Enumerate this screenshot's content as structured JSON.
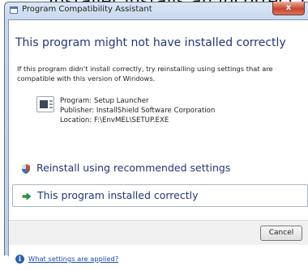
{
  "background": {
    "cut_text": "Installer installs an incorrect r"
  },
  "window": {
    "title": "Program Compatibility Assistant",
    "close_label": "x"
  },
  "main": {
    "heading": "This program might not have installed correctly",
    "description": "If this program didn't install correctly, try reinstalling using settings that are compatible with this version of Windows.",
    "program": {
      "name_line": "Program: Setup Launcher",
      "publisher_line": "Publisher: InstallShield Software Corporation",
      "location_line": "Location: F:\\EnvMEL\\SETUP.EXE",
      "icon": "setup-program-icon"
    },
    "options": [
      {
        "label": "Reinstall using recommended settings",
        "icon": "shield-icon"
      },
      {
        "label": "This program installed correctly",
        "icon": "arrow-icon"
      }
    ]
  },
  "buttons": {
    "cancel": "Cancel"
  },
  "footer": {
    "info_icon": "i",
    "link": "What settings are applied?"
  },
  "colors": {
    "heading": "#1f3777",
    "link": "#1a48b8",
    "title_bar": "#c7d9ef",
    "close_button": "#c9452f"
  }
}
